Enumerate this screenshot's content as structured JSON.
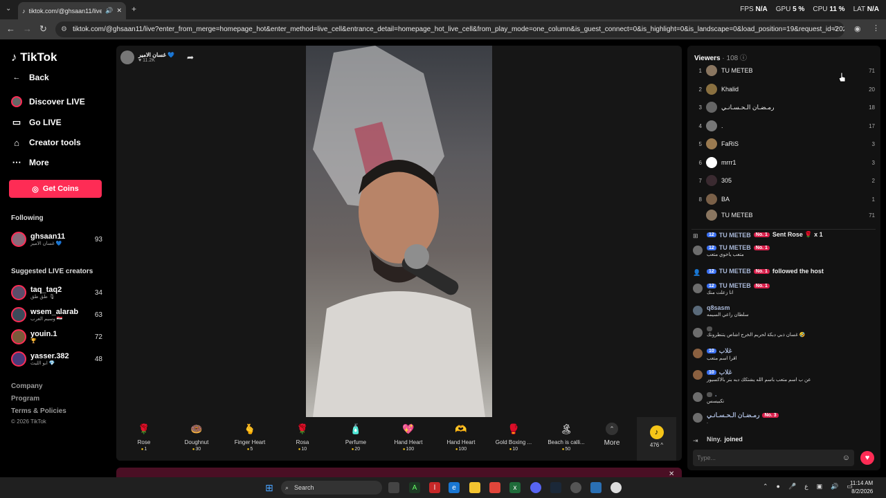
{
  "browser": {
    "tab_title": "tiktok.com/@ghsaan11/live",
    "url": "tiktok.com/@ghsaan11/live?enter_from_merge=homepage_hot&enter_method=live_cell&entrance_detail=homepage_hot_live_cell&from_play_mode=one_column&is_guest_connect=0&is_highlight=0&is_landscape=0&load_position=19&request_id=2026080216...",
    "perf": {
      "fps_label": "FPS",
      "fps": "N/A",
      "gpu_label": "GPU",
      "gpu": "5 %",
      "cpu_label": "CPU",
      "cpu": "11 %",
      "lat_label": "LAT",
      "lat": "N/A"
    }
  },
  "sidebar": {
    "logo": "TikTok",
    "back": "Back",
    "nav": [
      {
        "label": "Discover LIVE"
      },
      {
        "label": "Go LIVE"
      },
      {
        "label": "Creator tools"
      },
      {
        "label": "More"
      }
    ],
    "get_coins": "Get Coins",
    "following_title": "Following",
    "following": [
      {
        "name": "ghsaan11",
        "sub": "غسان الامير 💙",
        "count": "93"
      }
    ],
    "suggested_title": "Suggested LIVE creators",
    "suggested": [
      {
        "name": "taq_taq2",
        "sub": "طق طق 🎙",
        "count": "34"
      },
      {
        "name": "wsem_alarab",
        "sub": "وسيم العرب 🇮🇶",
        "count": "63"
      },
      {
        "name": "youin.1",
        "sub": "🏆",
        "count": "72"
      },
      {
        "name": "yasser.382",
        "sub": "ابو الليث 💎",
        "count": "48"
      }
    ],
    "footer": [
      "Company",
      "Program",
      "Terms & Policies",
      "© 2026 TikTok"
    ]
  },
  "stage": {
    "host_name": "غسان الامير 💙",
    "host_likes": "♥ 11.2K",
    "gifts": [
      {
        "name": "Rose",
        "price": "1",
        "icon": "🌹"
      },
      {
        "name": "Doughnut",
        "price": "30",
        "icon": "🍩"
      },
      {
        "name": "Finger Heart",
        "price": "5",
        "icon": "🫰"
      },
      {
        "name": "Rosa",
        "price": "10",
        "icon": "🌹"
      },
      {
        "name": "Perfume",
        "price": "20",
        "icon": "🧴"
      },
      {
        "name": "Hand Heart",
        "price": "100",
        "icon": "💖"
      },
      {
        "name": "Hand Heart",
        "price": "100",
        "icon": "🫶"
      },
      {
        "name": "Gold Boxing ...",
        "price": "10",
        "icon": "🥊"
      },
      {
        "name": "Beach is calli...",
        "price": "50",
        "icon": "🏝"
      }
    ],
    "more_label": "More",
    "coin_balance": "476 ^"
  },
  "panel": {
    "viewers_label": "Viewers",
    "viewers_count": "· 108",
    "viewers": [
      {
        "rank": "1",
        "name": "TU METEB",
        "score": "71"
      },
      {
        "rank": "2",
        "name": "Khalid",
        "score": "20"
      },
      {
        "rank": "3",
        "name": "رمـضـان الـحـسـانـي",
        "score": "18"
      },
      {
        "rank": "4",
        "name": ".",
        "score": "17"
      },
      {
        "rank": "5",
        "name": "FaRiS",
        "score": "3"
      },
      {
        "rank": "6",
        "name": "mrrr1",
        "score": "3"
      },
      {
        "rank": "7",
        "name": "305",
        "score": "2"
      },
      {
        "rank": "8",
        "name": "BA",
        "score": "1"
      },
      {
        "rank": "",
        "name": "TU METEB",
        "score": "71"
      }
    ],
    "chat": [
      {
        "level": "12",
        "user": "TU METEB",
        "badge": "No. 1",
        "action": "Sent Rose 🌹 x 1",
        "text": ""
      },
      {
        "level": "12",
        "user": "TU METEB",
        "badge": "No. 1",
        "action": "",
        "text": "متعب ياخوي متعب"
      },
      {
        "level": "12",
        "user": "TU METEB",
        "badge": "No. 1",
        "action": "followed the host",
        "text": ""
      },
      {
        "level": "12",
        "user": "TU METEB",
        "badge": "No. 1",
        "action": "",
        "text": "انا زعلت منك"
      },
      {
        "level": "",
        "user": "q8sasm",
        "badge": "",
        "action": "",
        "text": "سلطان راعي السيمه"
      },
      {
        "level": "",
        "user": "",
        "badge": "",
        "action": "",
        "text": "غسان ذبي دبكة لحريم الخرج اشاص يتنطرونك 🤣"
      },
      {
        "level": "10",
        "user": "غلاب",
        "badge": "",
        "action": "",
        "text": "اقرا اسم متعب"
      },
      {
        "level": "10",
        "user": "غلاب",
        "badge": "",
        "action": "",
        "text": "عن ب اسم متعب باسم الله يشتكك دبه بنر بالاكسيور"
      },
      {
        "level": "",
        "user": ".",
        "badge": "",
        "action": "",
        "text": "تكبيسس"
      },
      {
        "level": "",
        "user": "رمـضـان الـحـسـانـي",
        "badge": "No. 3",
        "action": "",
        "text": "."
      },
      {
        "level": "",
        "user": "Niny.",
        "badge": "",
        "action": "joined",
        "text": ""
      }
    ],
    "input_placeholder": "Type..."
  },
  "taskbar": {
    "search": "Search",
    "time": "11:14 AM",
    "date": "8/2/2026"
  }
}
